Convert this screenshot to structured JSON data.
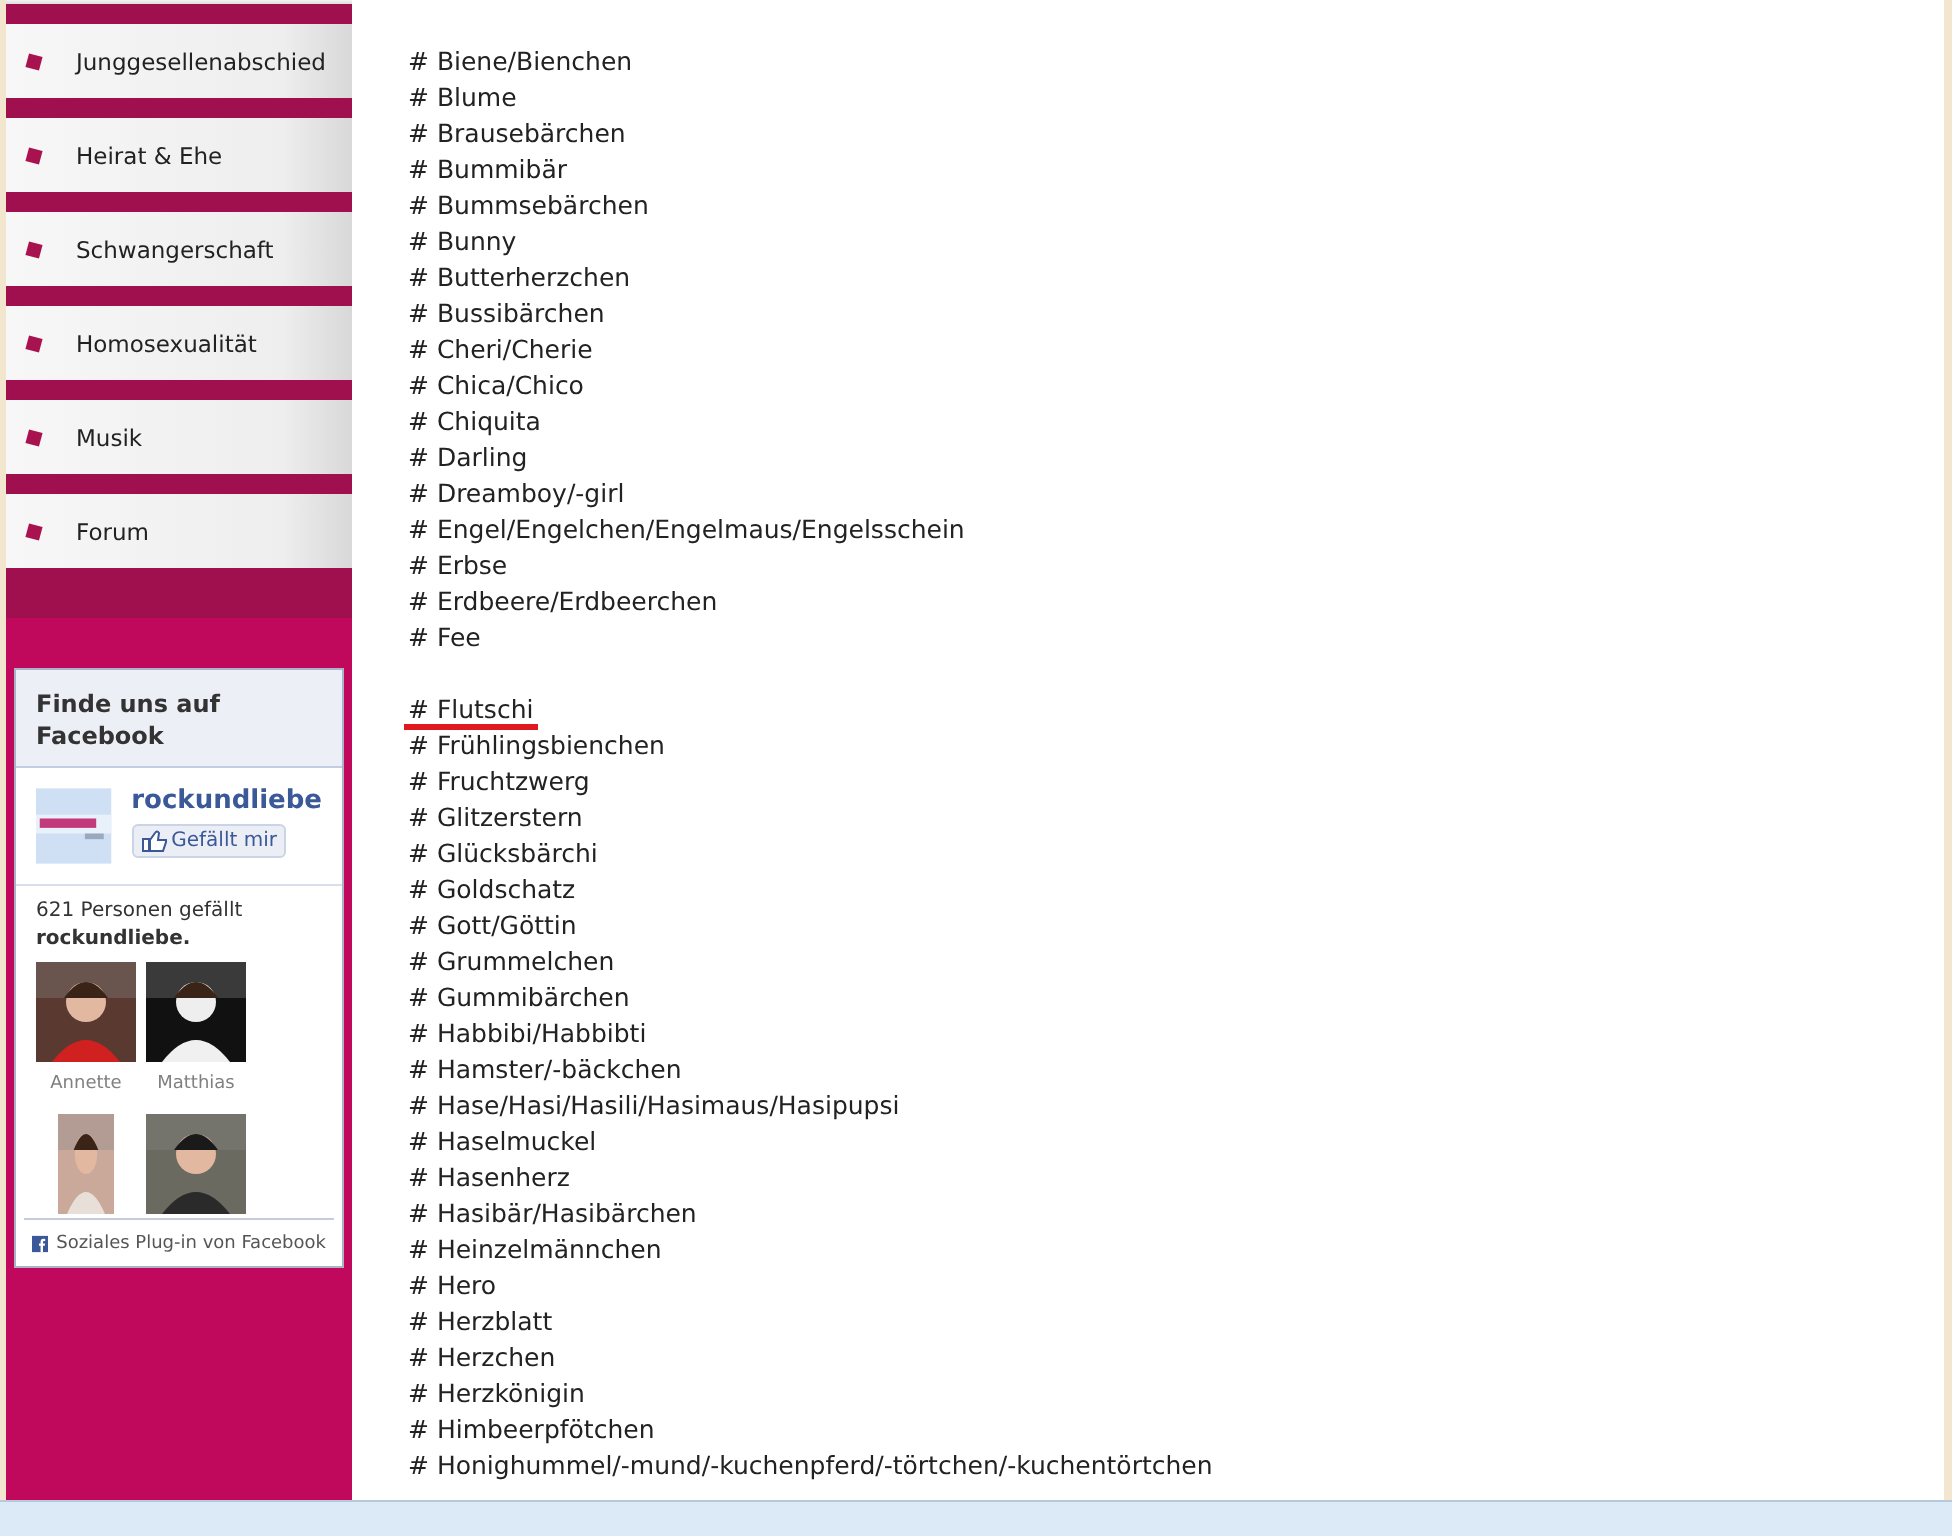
{
  "nav": [
    {
      "label": "Junggesellenabschied"
    },
    {
      "label": "Heirat & Ehe"
    },
    {
      "label": "Schwangerschaft"
    },
    {
      "label": "Homosexualität"
    },
    {
      "label": "Musik"
    },
    {
      "label": "Forum"
    }
  ],
  "facebook_box": {
    "title": "Finde uns auf Facebook",
    "page_name": "rockundliebe",
    "like_button": "Gefällt mir",
    "count_text": "621 Personen gefällt",
    "count_page": "rockundliebe.",
    "fans": [
      {
        "kind": "picture",
        "name": "Annette"
      },
      {
        "kind": "picture",
        "name": "Matthias"
      },
      {
        "kind": "picture"
      },
      {
        "kind": "picture"
      }
    ],
    "footer": "Soziales Plug-in von Facebook"
  },
  "name_groups": [
    [
      "# Biene/Bienchen",
      "# Blume",
      "# Brausebärchen",
      "# Bummibär",
      "# Bummsebärchen",
      "# Bunny",
      "# Butterherzchen",
      "# Bussibärchen",
      "# Cheri/Cherie",
      "# Chica/Chico",
      "# Chiquita",
      "# Darling",
      "# Dreamboy/-girl",
      "# Engel/Engelchen/Engelmaus/Engelsschein",
      "# Erbse",
      "# Erdbeere/Erdbeerchen",
      "# Fee"
    ],
    [
      {
        "text": "# Flutschi",
        "underlined": true
      },
      "# Frühlingsbienchen",
      "# Fruchtzwerg",
      "# Glitzerstern",
      "# Glücksbärchi",
      "# Goldschatz",
      "# Gott/Göttin",
      "# Grummelchen",
      "# Gummibärchen",
      "# Habbibi/Habbibti",
      "# Hamster/-bäckchen",
      "# Hase/Hasi/Hasili/Hasimaus/Hasipupsi",
      "# Haselmuckel",
      "# Hasenherz",
      "# Hasibär/Hasibärchen",
      "# Heinzelmännchen",
      "# Hero",
      "# Herzblatt",
      "# Herzchen",
      "# Herzkönigin",
      "# Himbeerpfötchen",
      "# Honighummel/-mund/-kuchenpferd/-törtchen/-kuchentörtchen"
    ]
  ]
}
